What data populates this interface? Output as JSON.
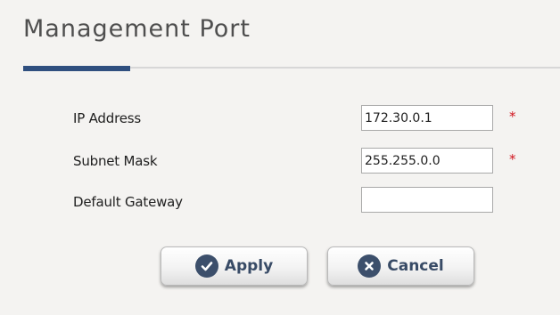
{
  "page": {
    "title": "Management Port"
  },
  "form": {
    "fields": [
      {
        "label": "IP Address",
        "value": "172.30.0.1",
        "required": true,
        "required_mark": "*"
      },
      {
        "label": "Subnet Mask",
        "value": "255.255.0.0",
        "required": true,
        "required_mark": "*"
      },
      {
        "label": "Default Gateway",
        "value": "",
        "required": false
      }
    ]
  },
  "buttons": {
    "apply": {
      "label": "Apply",
      "icon": "check-icon"
    },
    "cancel": {
      "label": "Cancel",
      "icon": "close-icon"
    }
  },
  "colors": {
    "accent": "#2f4f7f",
    "button_icon": "#3c4f6b",
    "button_text": "#384b66",
    "required": "#d0141e"
  }
}
